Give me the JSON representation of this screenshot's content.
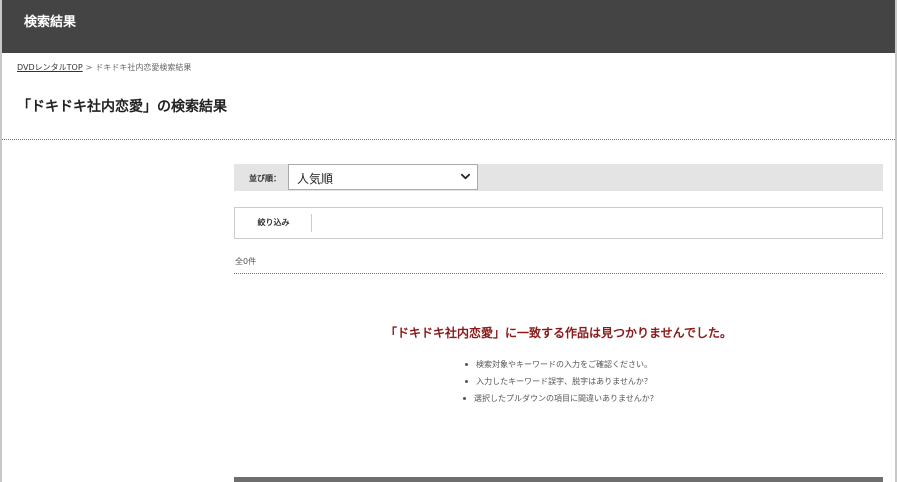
{
  "header": {
    "title": "検索結果"
  },
  "breadcrumb": {
    "home_link": "DVDレンタルTOP",
    "separator": ">",
    "current": "ドキドキ社内恋愛検索結果"
  },
  "page_title": "「ドキドキ社内恋愛」の検索結果",
  "sort": {
    "label": "並び順：",
    "selected": "人気順"
  },
  "filter": {
    "button_label": "絞り込み"
  },
  "results": {
    "count_text": "全0件",
    "no_results_message": "「ドキドキ社内恋愛」に一致する作品は見つかりませんでした。",
    "hints": [
      "検索対象やキーワードの入力をご確認ください。",
      "入力したキーワード誤字、脱字はありませんか？",
      "選択したプルダウンの項目に間違いありませんか?"
    ]
  },
  "colors": {
    "header_bg": "#444444",
    "sort_bar_bg": "#e4e4e4",
    "no_results_text": "#8b1a1a"
  },
  "icons": {
    "sort_dropdown": "chevron-down-icon",
    "hint_bullet": "bullet-icon"
  }
}
